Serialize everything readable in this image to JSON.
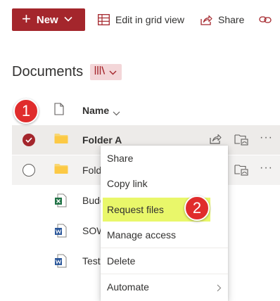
{
  "colors": {
    "brand": "#a4262c",
    "badge": "#e02c2c",
    "highlight": "#e9f76a",
    "selected_row": "#edebe9",
    "excel": "#217346",
    "word": "#2b579a",
    "folder": "#f8d775"
  },
  "command_bar": {
    "new_label": "New",
    "grid_view_label": "Edit in grid view",
    "share_label": "Share",
    "icons": [
      "plus-icon",
      "chevron-down-icon",
      "grid-icon",
      "share-icon",
      "link-icon"
    ]
  },
  "library": {
    "title": "Documents",
    "view_icon": "library-icon"
  },
  "header": {
    "name_label": "Name",
    "file_type_icon": "document-icon"
  },
  "badges": {
    "step1": "1",
    "step2": "2"
  },
  "rows": [
    {
      "name": "Folder A",
      "type": "folder",
      "icon": "folder-icon",
      "selected": true
    },
    {
      "name": "Fold",
      "type": "folder",
      "icon": "folder-icon",
      "selected": false
    },
    {
      "name": "Budg",
      "type": "excel",
      "icon": "excel-icon",
      "selected": false
    },
    {
      "name": "SOW",
      "type": "word",
      "icon": "word-icon",
      "selected": false
    },
    {
      "name": "Test",
      "type": "word",
      "icon": "word-icon",
      "selected": false
    }
  ],
  "row_actions": {
    "more_label": "···"
  },
  "context_menu": {
    "items": [
      {
        "label": "Share"
      },
      {
        "label": "Copy link"
      },
      {
        "label": "Request files",
        "highlighted": true
      },
      {
        "label": "Manage access"
      },
      {
        "label": "Delete"
      },
      {
        "label": "Automate",
        "submenu": true
      }
    ]
  }
}
